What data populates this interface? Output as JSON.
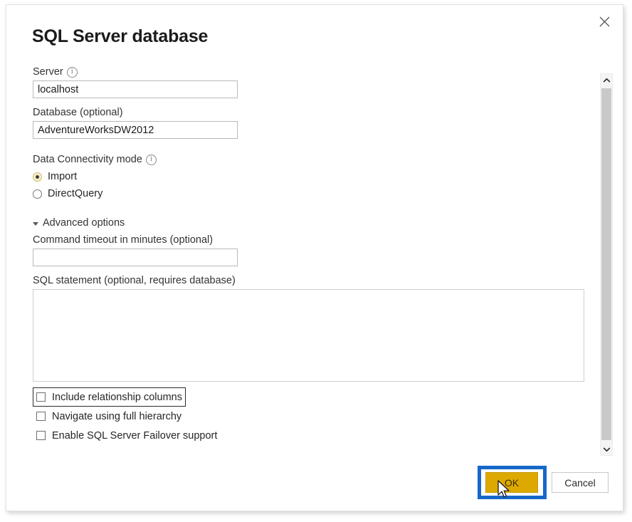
{
  "dialog": {
    "title": "SQL Server database",
    "close_icon": "close-icon"
  },
  "form": {
    "server": {
      "label": "Server",
      "info_icon": "info-icon",
      "value": "localhost",
      "placeholder": ""
    },
    "database": {
      "label": "Database (optional)",
      "value": "AdventureWorksDW2012",
      "placeholder": ""
    },
    "connectivity": {
      "label": "Data Connectivity mode",
      "info_icon": "info-icon",
      "options": [
        {
          "label": "Import",
          "selected": true
        },
        {
          "label": "DirectQuery",
          "selected": false
        }
      ]
    },
    "advanced": {
      "label": "Advanced options",
      "expanded": true,
      "disclosure_icon": "triangle-expanded-icon",
      "command_timeout": {
        "label": "Command timeout in minutes (optional)",
        "value": "",
        "placeholder": ""
      },
      "sql_statement": {
        "label": "SQL statement (optional, requires database)",
        "value": "",
        "placeholder": ""
      },
      "checkboxes": [
        {
          "label": "Include relationship columns",
          "checked": false,
          "focused": true
        },
        {
          "label": "Navigate using full hierarchy",
          "checked": false,
          "focused": false
        },
        {
          "label": "Enable SQL Server Failover support",
          "checked": false,
          "focused": false
        }
      ]
    }
  },
  "scrollbar": {
    "up_icon": "chevron-up-icon",
    "down_icon": "chevron-down-icon"
  },
  "footer": {
    "ok_label": "OK",
    "cancel_label": "Cancel"
  },
  "colors": {
    "ok_button": "#dda900",
    "annotation_highlight": "#1668c8",
    "radio_selected_fill": "#f7f0c8",
    "scrollbar_thumb": "#c9c9c9"
  }
}
